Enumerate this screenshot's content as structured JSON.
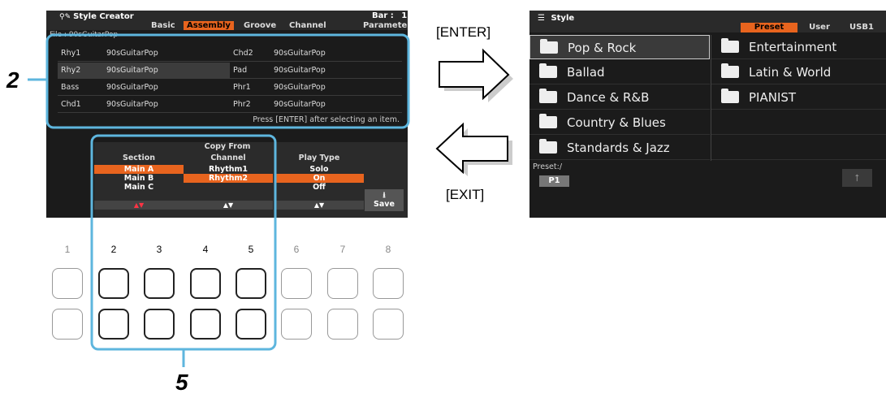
{
  "left_screen": {
    "title": "Style Creator",
    "tabs": [
      "Basic",
      "Assembly",
      "Groove",
      "Channel",
      "Parameter"
    ],
    "active_tab": "Assembly",
    "bar_label": "Bar :",
    "bar_value": "1",
    "file_label": "File : 90sGuitarPop",
    "channels": [
      {
        "left_ch": "Rhy1",
        "left_style": "90sGuitarPop",
        "right_ch": "Chd2",
        "right_style": "90sGuitarPop"
      },
      {
        "left_ch": "Rhy2",
        "left_style": "90sGuitarPop",
        "right_ch": "Pad",
        "right_style": "90sGuitarPop"
      },
      {
        "left_ch": "Bass",
        "left_style": "90sGuitarPop",
        "right_ch": "Phr1",
        "right_style": "90sGuitarPop"
      },
      {
        "left_ch": "Chd1",
        "left_style": "90sGuitarPop",
        "right_ch": "Phr2",
        "right_style": "90sGuitarPop"
      }
    ],
    "message": "Press [ENTER] after selecting an item.",
    "copy_from": {
      "title": "Copy From",
      "section_header": "Section",
      "sections": [
        "Main A",
        "Main B",
        "Main C"
      ],
      "selected_section": "Main A",
      "channel_header": "Channel",
      "channels": [
        "Rhythm1",
        "Rhythm2"
      ],
      "selected_channel": "Rhythm2",
      "play_type_header": "Play Type",
      "play_types": [
        "Solo",
        "On",
        "Off"
      ],
      "selected_play_type": "On",
      "arrow_label": "▲▼"
    },
    "save_label": "Save",
    "save_icon": "save-arrow-icon"
  },
  "right_screen": {
    "title": "Style",
    "tabs": [
      "Preset",
      "User",
      "USB1"
    ],
    "active_tab": "Preset",
    "folders_left": [
      "Pop & Rock",
      "Ballad",
      "Dance & R&B",
      "Country & Blues",
      "Standards & Jazz"
    ],
    "folders_right": [
      "Entertainment",
      "Latin & World",
      "PIANIST"
    ],
    "selected_folder": "Pop & Rock",
    "path": "Preset:/",
    "page_label": "P1",
    "up_icon": "folder-up-icon"
  },
  "labels": {
    "enter": "[ENTER]",
    "exit": "[EXIT]",
    "step_2": "2",
    "step_5": "5"
  },
  "buttons": {
    "numbers": [
      "1",
      "2",
      "3",
      "4",
      "5",
      "6",
      "7",
      "8"
    ],
    "highlighted": [
      "2",
      "3",
      "4",
      "5"
    ]
  },
  "colors": {
    "accent": "#e8641e",
    "callout": "#5eb6de",
    "screen_bg": "#1b1b1b"
  }
}
